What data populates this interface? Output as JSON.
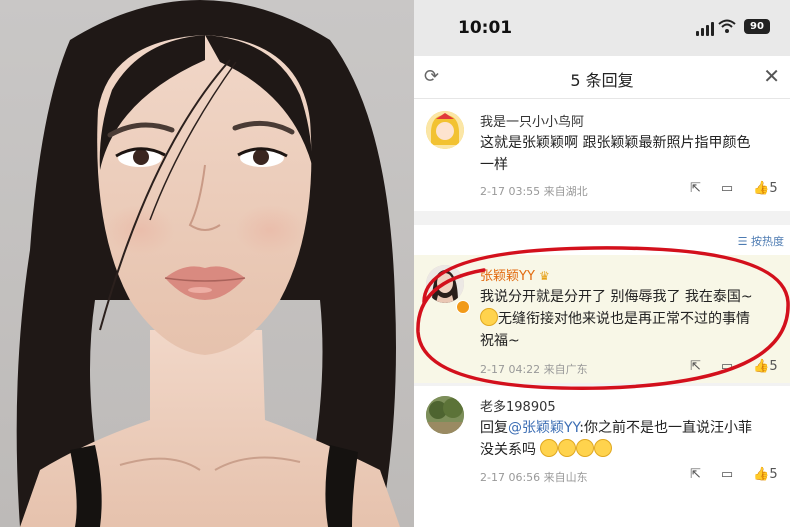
{
  "status_bar": {
    "time": "10:01",
    "battery": "90"
  },
  "header": {
    "title": "5 条回复",
    "refresh_icon": "refresh-icon",
    "close_icon": "close-icon"
  },
  "sort": {
    "label": "按热度"
  },
  "comments": [
    {
      "username": "我是一只小小鸟阿",
      "text_line1": "这就是张颖颖啊 跟张颖颖最新照片指甲颜色",
      "text_line2": "一样",
      "meta": "2-17 03:55  来自湖北",
      "likes": "5"
    },
    {
      "username": "张颖颖YY",
      "text_line1": "我说分开就是分开了 别侮辱我了 我在泰国~",
      "text_line2": "无缝衔接对他来说也是再正常不过的事情",
      "text_line3": "祝福~",
      "meta": "2-17 04:22  来自广东",
      "likes": "5"
    },
    {
      "username": "老多198905",
      "reply_prefix": "回复",
      "mention": "@张颖颖YY",
      "text_line1": ":你之前不是也一直说汪小菲",
      "text_line2": "没关系吗",
      "meta": "2-17 06:56  来自山东",
      "likes": "5"
    }
  ],
  "colors": {
    "highlight_oval": "#d3101c",
    "mention": "#3c6eb4",
    "accent_badge": "#f19a1a"
  }
}
